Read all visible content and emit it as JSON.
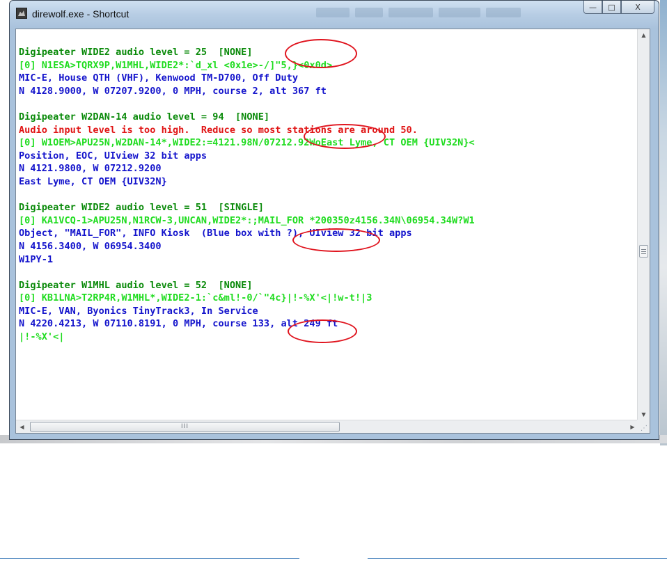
{
  "window": {
    "title": "direwolf.exe - Shortcut",
    "buttons": {
      "minimize": "—",
      "maximize": "□",
      "close": "X"
    }
  },
  "console": {
    "lines": [
      {
        "text": "Digipeater WIDE2 audio level = 25  [NONE]",
        "color": "green"
      },
      {
        "text": "[0] N1ESA>TQRX9P,W1MHL,WIDE2*:`d_xl <0x1e>-/]\"5,}<0x0d>",
        "color": "lime"
      },
      {
        "text": "MIC-E, House QTH (VHF), Kenwood TM-D700, Off Duty",
        "color": "blue"
      },
      {
        "text": "N 4128.9000, W 07207.9200, 0 MPH, course 2, alt 367 ft",
        "color": "blue"
      },
      {
        "text": "",
        "color": "blue"
      },
      {
        "text": "Digipeater W2DAN-14 audio level = 94  [NONE]",
        "color": "green"
      },
      {
        "text": "Audio input level is too high.  Reduce so most stations are around 50.",
        "color": "red"
      },
      {
        "text": "[0] W1OEM>APU25N,W2DAN-14*,WIDE2:=4121.98N/07212.92WoEast Lyme, CT OEM {UIV32N}<",
        "color": "lime"
      },
      {
        "text": "Position, EOC, UIview 32 bit apps",
        "color": "blue"
      },
      {
        "text": "N 4121.9800, W 07212.9200",
        "color": "blue"
      },
      {
        "text": "East Lyme, CT OEM {UIV32N}",
        "color": "blue"
      },
      {
        "text": "",
        "color": "blue"
      },
      {
        "text": "Digipeater WIDE2 audio level = 51  [SINGLE]",
        "color": "green"
      },
      {
        "text": "[0] KA1VCQ-1>APU25N,N1RCW-3,UNCAN,WIDE2*:;MAIL_FOR *200350z4156.34N\\06954.34W?W1",
        "color": "lime"
      },
      {
        "text": "Object, \"MAIL_FOR\", INFO Kiosk  (Blue box with ?), UIview 32 bit apps",
        "color": "blue"
      },
      {
        "text": "N 4156.3400, W 06954.3400",
        "color": "blue"
      },
      {
        "text": "W1PY-1",
        "color": "blue"
      },
      {
        "text": "",
        "color": "blue"
      },
      {
        "text": "Digipeater W1MHL audio level = 52  [NONE]",
        "color": "green"
      },
      {
        "text": "[0] KB1LNA>T2RP4R,W1MHL*,WIDE2-1:`c&ml!-0/`\"4c}|!-%X'<|!w-t!|3",
        "color": "lime"
      },
      {
        "text": "MIC-E, VAN, Byonics TinyTrack3, In Service",
        "color": "blue"
      },
      {
        "text": "N 4220.4213, W 07110.8191, 0 MPH, course 133, alt 249 ft",
        "color": "blue"
      },
      {
        "text": "|!-%X'<|",
        "color": "lime"
      }
    ]
  },
  "scrollbars": {
    "vertical": {
      "up": "▲",
      "down": "▼"
    },
    "horizontal": {
      "left": "◀",
      "right": "▶",
      "thumb_grip": "III"
    }
  },
  "colors": {
    "green": "#0a8a0a",
    "lime": "#1fdc1f",
    "blue": "#1414cc",
    "red": "#e01414",
    "annotation": "#e0141e"
  },
  "icons": {
    "app": "wolf-app-icon",
    "minimize": "minimize-icon",
    "maximize": "maximize-icon",
    "close": "close-icon"
  }
}
